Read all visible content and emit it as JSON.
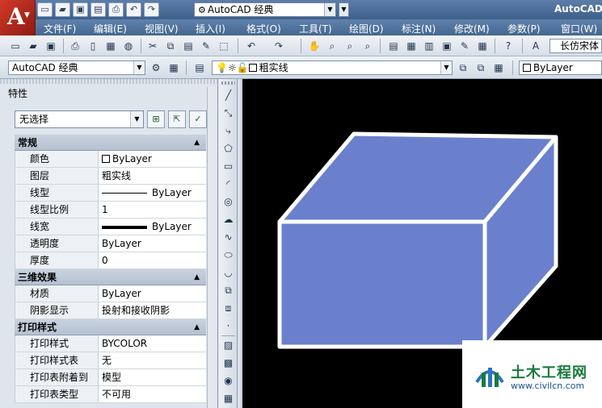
{
  "titlebar": {
    "app_title": "AutoCAD",
    "workspace": "AutoCAD 经典",
    "logo_letter": "A",
    "quick_access_icons": [
      "new-icon",
      "open-icon",
      "save-icon",
      "save-as-icon",
      "print-icon",
      "undo-icon",
      "redo-icon"
    ]
  },
  "menu": {
    "items": [
      "文件(F)",
      "编辑(E)",
      "视图(V)",
      "插入(I)",
      "格式(O)",
      "工具(T)",
      "绘图(D)",
      "标注(N)",
      "修改(M)",
      "参数(P)",
      "窗口(W)"
    ]
  },
  "toolbar2": {
    "workspace_combo": "AutoCAD 经典",
    "layer_combo": "粗实线",
    "color_combo": "ByLayer",
    "font_combo": "长仿宋体"
  },
  "properties": {
    "title": "特性",
    "selection": "无选择",
    "sections": [
      {
        "title": "常规",
        "rows": [
          {
            "name": "颜色",
            "value": "ByLayer"
          },
          {
            "name": "图层",
            "value": "粗实线"
          },
          {
            "name": "线型",
            "value": "ByLayer"
          },
          {
            "name": "线型比例",
            "value": "1"
          },
          {
            "name": "线宽",
            "value": "ByLayer"
          },
          {
            "name": "透明度",
            "value": "ByLayer"
          },
          {
            "name": "厚度",
            "value": "0"
          }
        ]
      },
      {
        "title": "三维效果",
        "rows": [
          {
            "name": "材质",
            "value": "ByLayer"
          },
          {
            "name": "阴影显示",
            "value": "投射和接收阴影"
          }
        ]
      },
      {
        "title": "打印样式",
        "rows": [
          {
            "name": "打印样式",
            "value": "BYCOLOR"
          },
          {
            "name": "打印样式表",
            "value": "无"
          },
          {
            "name": "打印表附着到",
            "value": "模型"
          },
          {
            "name": "打印表类型",
            "value": "不可用"
          }
        ]
      }
    ]
  },
  "canvas": {
    "background": "#000000",
    "box_fill": "#6a80cc",
    "box_stroke": "#ffffff"
  },
  "watermark": {
    "name": "土木工程网",
    "url": "www.civilcn.com"
  },
  "colors": {
    "titlebar": "#4a6b95",
    "palette_bg": "#dfe5ec"
  }
}
